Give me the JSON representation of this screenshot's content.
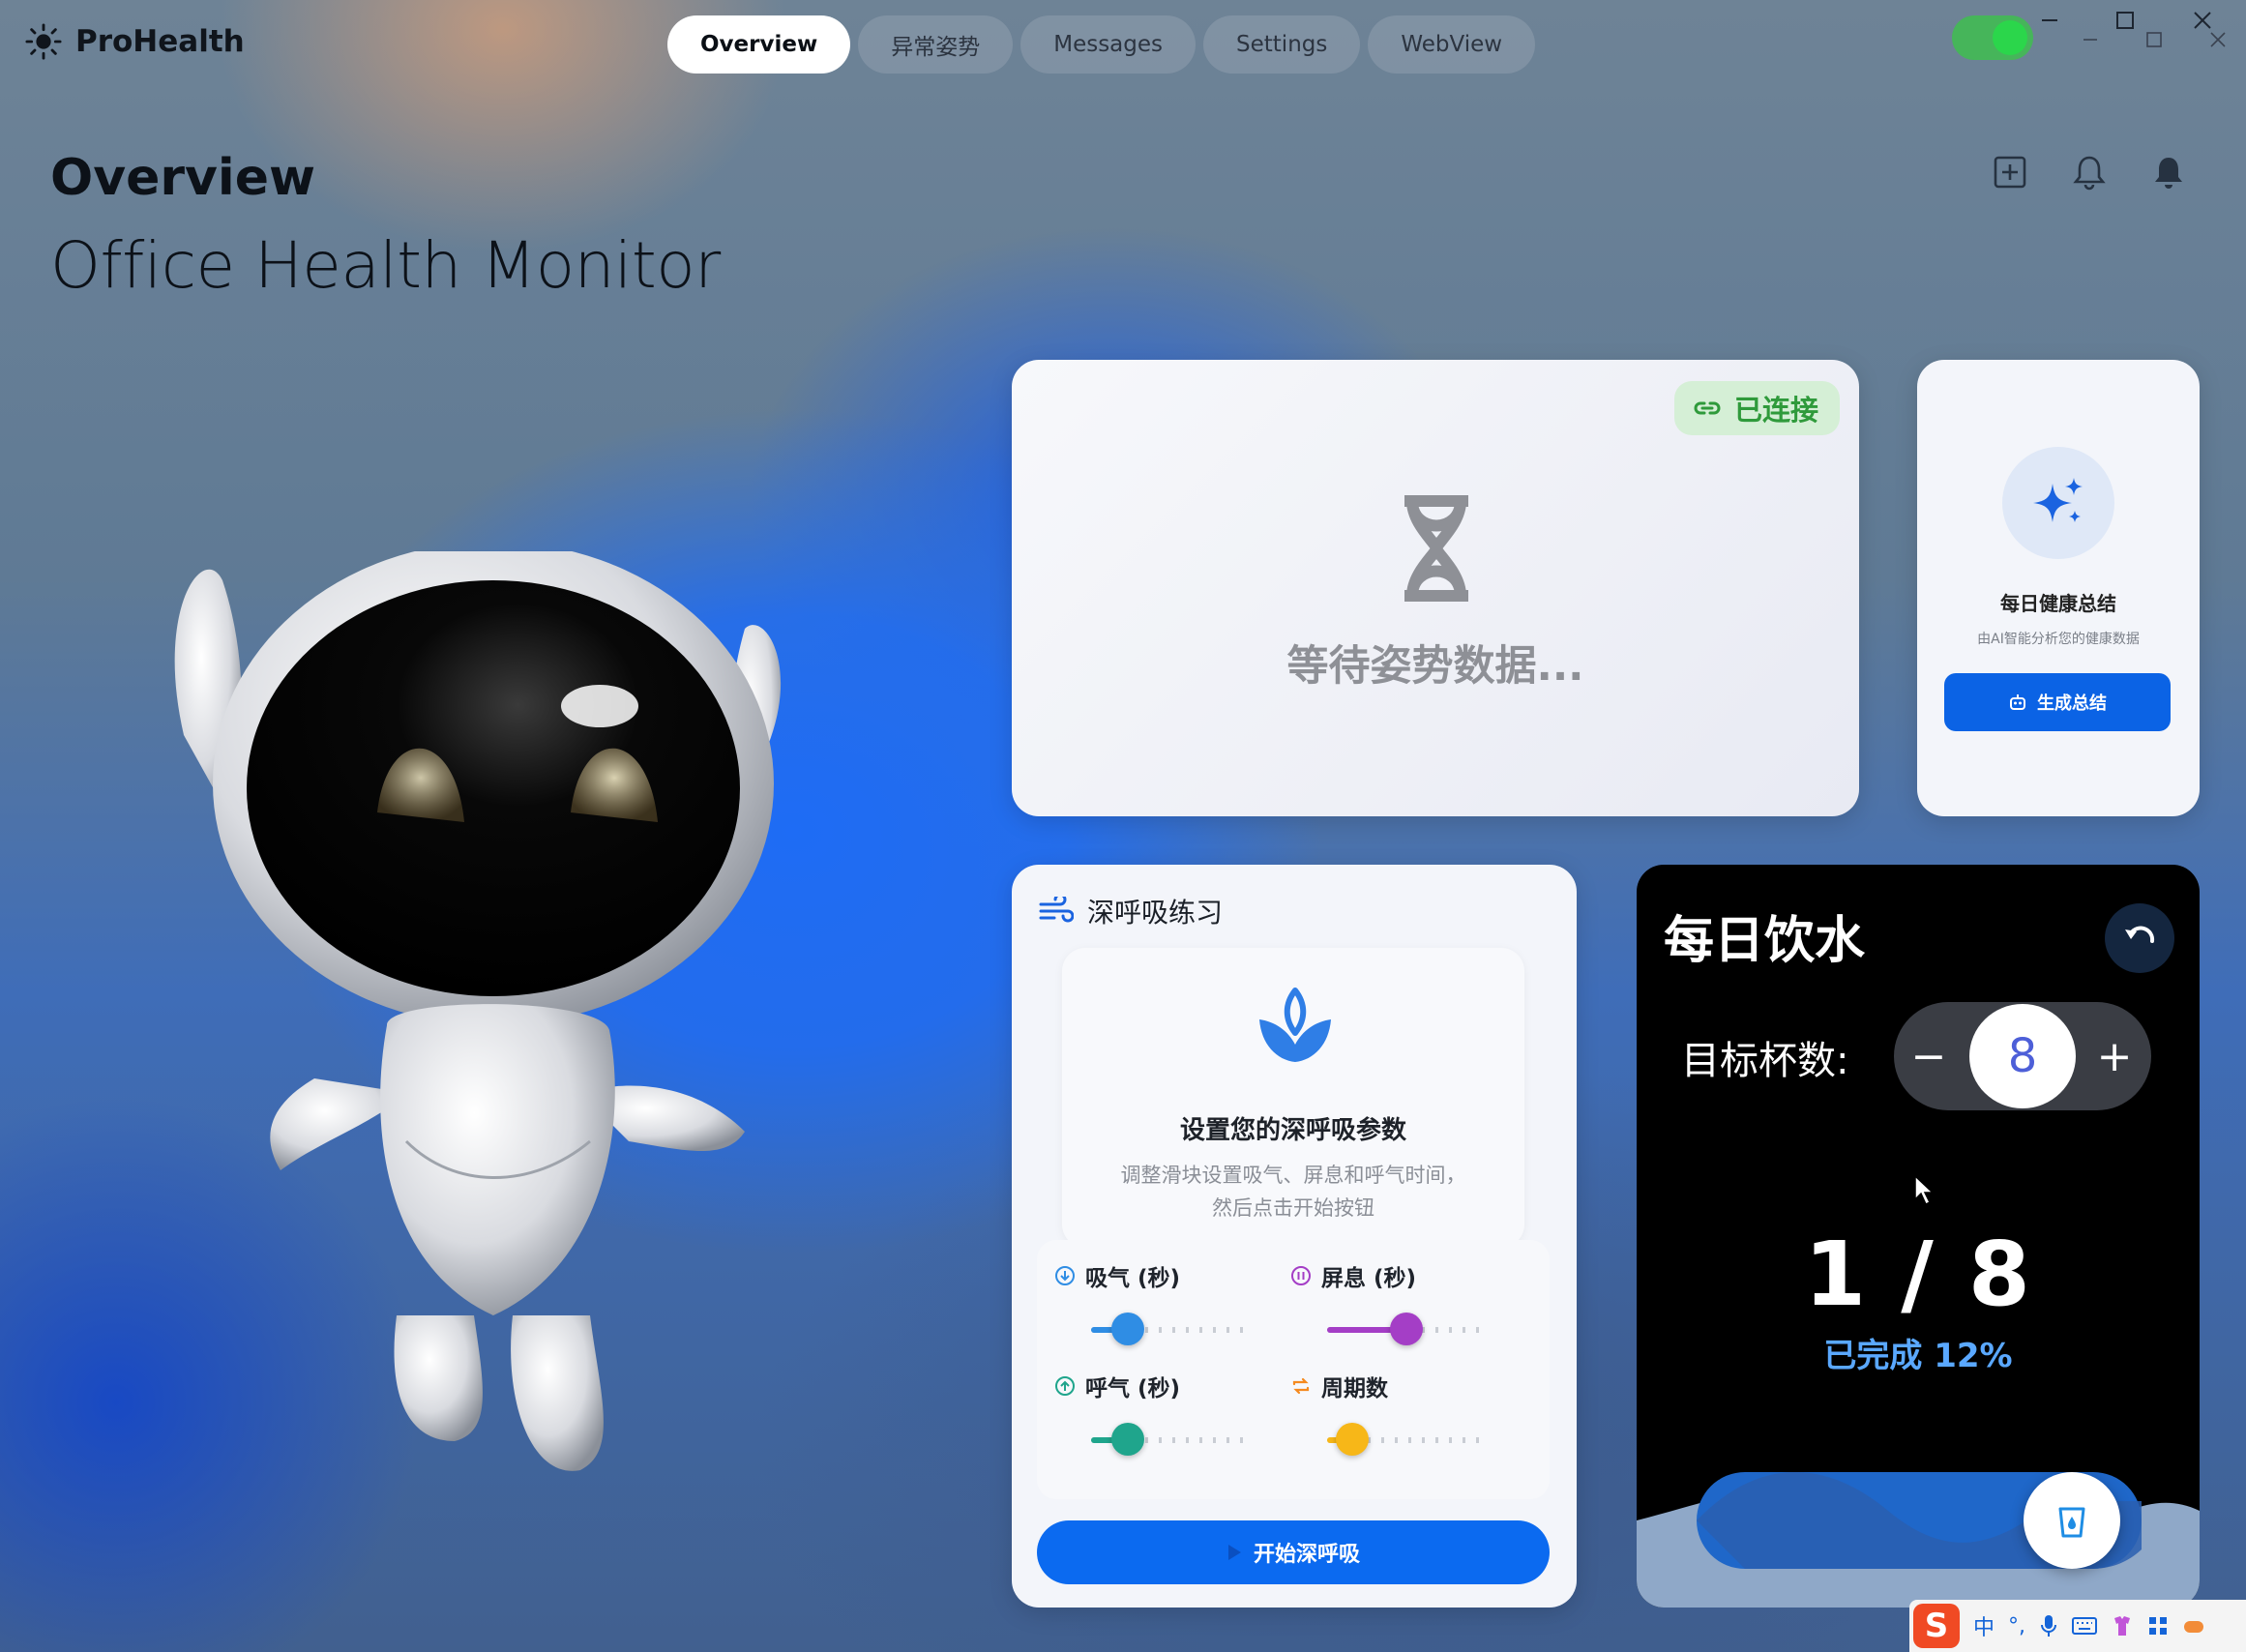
{
  "app": {
    "name": "ProHealth"
  },
  "tabs": [
    {
      "label": "Overview",
      "active": true
    },
    {
      "label": "异常姿势",
      "active": false
    },
    {
      "label": "Messages",
      "active": false
    },
    {
      "label": "Settings",
      "active": false
    },
    {
      "label": "WebView",
      "active": false
    }
  ],
  "header": {
    "title": "Overview",
    "subtitle": "Office Health Monitor"
  },
  "header_icons": [
    "add-square-icon",
    "bell-outline-icon",
    "bell-filled-icon"
  ],
  "posture_card": {
    "status_badge": "已连接",
    "waiting_text": "等待姿势数据..."
  },
  "summary_card": {
    "title": "每日健康总结",
    "description": "由AI智能分析您的健康数据",
    "button_label": "生成总结"
  },
  "breathing_card": {
    "title": "深呼吸练习",
    "intro_title": "设置您的深呼吸参数",
    "intro_desc_line1": "调整滑块设置吸气、屏息和呼气时间，",
    "intro_desc_line2": "然后点击开始按钮",
    "sliders": [
      {
        "label": "吸气 (秒)",
        "color": "#2f8de4",
        "fraction": 0.23
      },
      {
        "label": "屏息 (秒)",
        "color": "#a43ec6",
        "fraction": 0.5
      },
      {
        "label": "呼气 (秒)",
        "color": "#1fa58c",
        "fraction": 0.23
      },
      {
        "label": "周期数",
        "color": "#f7b718",
        "fraction": 0.16
      }
    ],
    "start_button": "开始深呼吸"
  },
  "water_card": {
    "title": "每日饮水",
    "goal_label": "目标杯数:",
    "goal_value": "8",
    "minus": "−",
    "plus": "+",
    "progress_text": "1 / 8",
    "completed_text": "已完成 12%"
  },
  "ime": {
    "logo": "S",
    "mode": "中"
  },
  "colors": {
    "accent": "#0b63e5",
    "connected": "#2f9a3b",
    "water_highlight": "#5aa8ff"
  }
}
